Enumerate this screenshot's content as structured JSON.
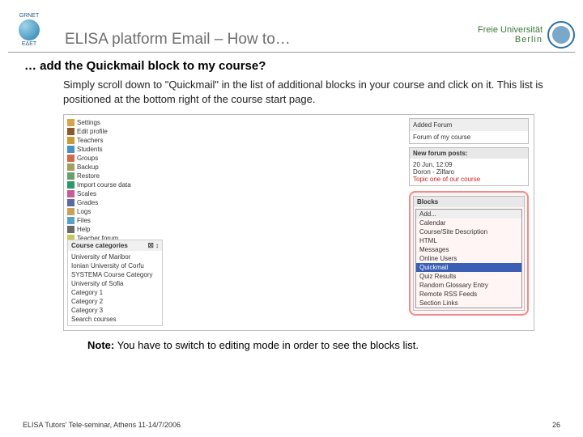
{
  "header": {
    "left_logo_top": "GRNET",
    "left_logo_bottom": "ΕΔΕΤ",
    "title": "ELISA platform Email – How to…",
    "fu_text": "Freie Universität",
    "fu_city": "Berlin"
  },
  "subtitle": "… add the Quickmail block to my course?",
  "intro": "Simply scroll down to \"Quickmail\" in the list of additional blocks in your course and click on it. This list is positioned at the bottom right of the course start page.",
  "admin_items": [
    {
      "c": "#d9a44a",
      "t": "Settings"
    },
    {
      "c": "#8a5a2a",
      "t": "Edit profile"
    },
    {
      "c": "#c79a3a",
      "t": "Teachers"
    },
    {
      "c": "#4a90c2",
      "t": "Students"
    },
    {
      "c": "#d06a4a",
      "t": "Groups"
    },
    {
      "c": "#a0a060",
      "t": "Backup"
    },
    {
      "c": "#6aa06a",
      "t": "Restore"
    },
    {
      "c": "#2a9a6a",
      "t": "Import course data"
    },
    {
      "c": "#c85a9a",
      "t": "Scales"
    },
    {
      "c": "#5a6aa0",
      "t": "Grades"
    },
    {
      "c": "#c8a05a",
      "t": "Logs"
    },
    {
      "c": "#5aa0c8",
      "t": "Files"
    },
    {
      "c": "#6a6a6a",
      "t": "Help"
    },
    {
      "c": "#c8c85a",
      "t": "Teacher forum"
    }
  ],
  "categories": {
    "hdr": "Course categories",
    "ctrl": "☒ ↕",
    "items": [
      "University of Maribor",
      "Ionian University of Corfu",
      "SYSTEMA Course Category",
      "University of Sofia",
      "Category 1",
      "Category 2",
      "Category 3",
      "Search courses"
    ]
  },
  "right": {
    "added": {
      "hdr": "Added Forum",
      "body": "Forum of my course"
    },
    "posts": {
      "hdr": "New forum posts:",
      "l1": "20 Jun, 12:09",
      "l2": "Doron - Zilfaro",
      "l3": "Topic one of our course"
    },
    "blocks": {
      "hdr": "Blocks",
      "add": "Add...",
      "items": [
        "Calendar",
        "Course/Site Description",
        "HTML",
        "Messages",
        "Online Users"
      ],
      "selected": "Quickmail",
      "items2": [
        "Quiz Results",
        "Random Glossary Entry",
        "Remote RSS Feeds",
        "Section Links"
      ]
    }
  },
  "note_label": "Note:",
  "note_text": " You have to switch to editing mode in order to see the blocks list.",
  "footer_left": "ELISA Tutors' Tele-seminar, Athens 11-14/7/2006",
  "footer_right": "26"
}
